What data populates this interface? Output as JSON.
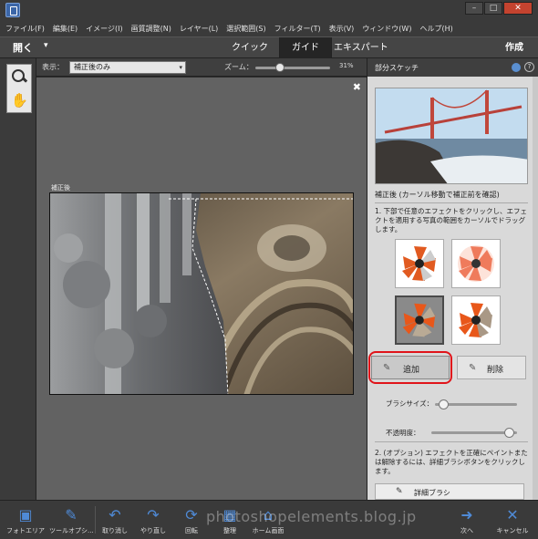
{
  "window": {
    "minimize_glyph": "–",
    "restore_glyph": "□",
    "close_glyph": "✕"
  },
  "menu": [
    "ファイル(F)",
    "編集(E)",
    "イメージ(I)",
    "画質調整(N)",
    "レイヤー(L)",
    "選択範囲(S)",
    "フィルター(T)",
    "表示(V)",
    "ウィンドウ(W)",
    "ヘルプ(H)"
  ],
  "modebar": {
    "open_label": "開く",
    "open_arrow": "▾",
    "tabs": [
      "クイック",
      "ガイド",
      "エキスパート"
    ],
    "active_tab": "ガイド",
    "create_label": "作成"
  },
  "options": {
    "view_label": "表示：",
    "view_value": "補正後のみ",
    "view_caret": "▾",
    "zoom_label": "ズーム：",
    "zoom_percent": 31,
    "zoom_value": "31%"
  },
  "canvas": {
    "close_glyph": "✖",
    "after_label": "補正後"
  },
  "panel": {
    "title": "部分スケッチ",
    "help_glyph": "?",
    "preview_caption": "補正後 (カーソル移動で補正前を確認)",
    "instruction1": "1. 下部で任意のエフェクトをクリックし、エフェクトを適用する写真の範囲をカーソルでドラッグします。",
    "add_label": "追加",
    "delete_label": "削除",
    "brush_icon": "✎",
    "brush_size_label": "ブラシサイズ：",
    "brush_size_fraction": 0.05,
    "opacity_label": "不透明度：",
    "opacity_fraction": 0.96,
    "instruction2": "2. (オプション) エフェクトを正確にペイントまたは解除するには、詳細ブラシボタンをクリックします。",
    "detail_brush_label": "詳細ブラシ"
  },
  "bottom": {
    "items": [
      {
        "label": "フォトエリア",
        "icon": "▣"
      },
      {
        "label": "ツールオプシ...",
        "icon": "✎"
      },
      {
        "label": "取り消し",
        "icon": "↶"
      },
      {
        "label": "やり直し",
        "icon": "↷"
      },
      {
        "label": "回転",
        "icon": "⟳"
      },
      {
        "label": "整理",
        "icon": "▦"
      },
      {
        "label": "ホーム画面",
        "icon": "⌂"
      },
      {
        "label": "次へ",
        "icon": "➜"
      },
      {
        "label": "キャンセル",
        "icon": "✕"
      }
    ],
    "watermark": "photoshopelements.blog.jp"
  },
  "colors": {
    "accent_blue": "#4f8ad6",
    "highlight_red": "#e0141a",
    "cancel_blue": "#3d6fb8"
  }
}
